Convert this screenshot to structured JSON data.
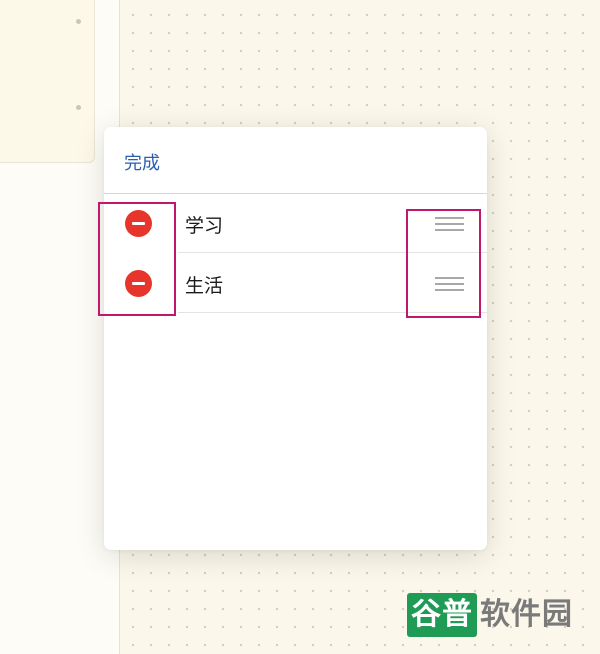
{
  "popup": {
    "done_label": "完成",
    "items": [
      {
        "label": "学习"
      },
      {
        "label": "生活"
      }
    ]
  },
  "watermark": {
    "highlight_text": "谷普",
    "rest_text": "软件园"
  },
  "colors": {
    "accent_blue": "#2a5fb0",
    "delete_red": "#e8352b",
    "highlight_magenta": "#c2176e",
    "watermark_green": "#1f9b56"
  },
  "icons": {
    "delete": "minus-circle-icon",
    "reorder": "drag-handle-icon"
  }
}
